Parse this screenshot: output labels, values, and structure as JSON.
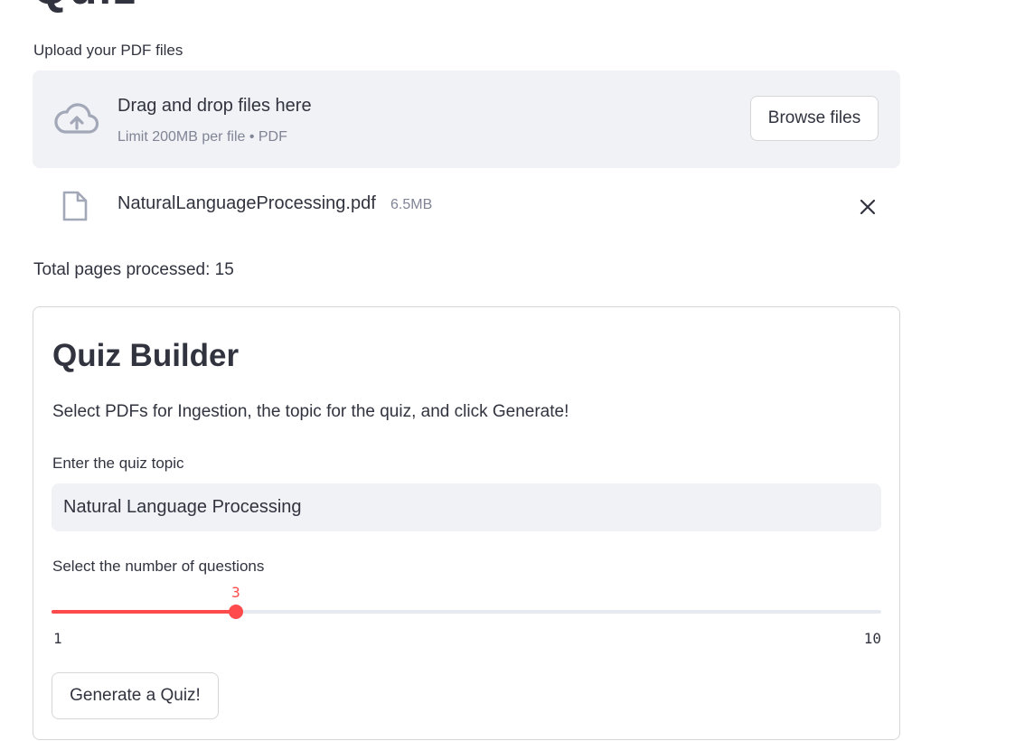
{
  "page_title_partial": "Quiz",
  "uploader": {
    "label": "Upload your PDF files",
    "drop_title": "Drag and drop files here",
    "drop_limit": "Limit 200MB per file • PDF",
    "browse_label": "Browse files",
    "icon": "cloud-upload-icon"
  },
  "uploaded_file": {
    "name": "NaturalLanguageProcessing.pdf",
    "size": "6.5MB",
    "icon": "file-icon",
    "remove_icon": "close-icon"
  },
  "status": {
    "pages_processed": "Total pages processed: 15"
  },
  "quiz_builder": {
    "title": "Quiz Builder",
    "description": "Select PDFs for Ingestion, the topic for the quiz, and click Generate!",
    "topic_label": "Enter the quiz topic",
    "topic_value": "Natural Language Processing",
    "num_label": "Select the number of questions",
    "slider": {
      "min": 1,
      "max": 10,
      "value": 3,
      "min_label": "1",
      "max_label": "10",
      "value_label": "3"
    },
    "generate_label": "Generate a Quiz!"
  },
  "colors": {
    "accent": "#ff4b4b",
    "text": "#31333f",
    "muted": "#808495",
    "surface": "#f0f2f6",
    "border": "#d6d6d9"
  }
}
